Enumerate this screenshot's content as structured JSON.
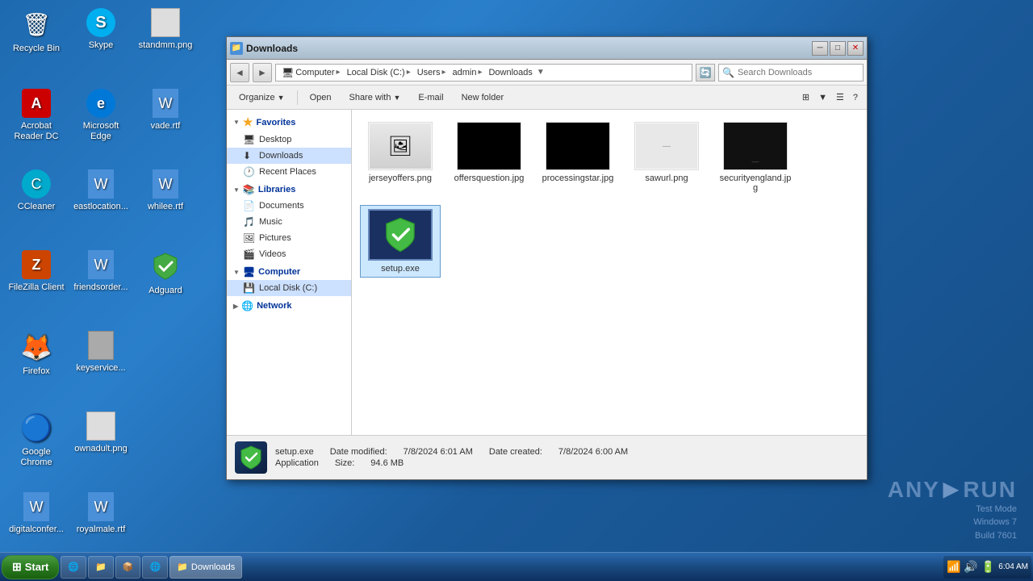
{
  "window": {
    "title": "Downloads",
    "titlebar_icon": "📁"
  },
  "address_bar": {
    "path": "Computer > Local Disk (C:) > Users > admin > Downloads",
    "segments": [
      "Computer",
      "Local Disk (C:)",
      "Users",
      "admin",
      "Downloads"
    ],
    "search_placeholder": "Search Downloads"
  },
  "toolbar": {
    "organize_label": "Organize",
    "open_label": "Open",
    "share_with_label": "Share with",
    "email_label": "E-mail",
    "new_folder_label": "New folder"
  },
  "sidebar": {
    "favorites_label": "Favorites",
    "favorites_items": [
      {
        "label": "Desktop",
        "icon": "🖥"
      },
      {
        "label": "Downloads",
        "icon": "⬇"
      },
      {
        "label": "Recent Places",
        "icon": "🕐"
      }
    ],
    "libraries_label": "Libraries",
    "libraries_items": [
      {
        "label": "Documents",
        "icon": "📄"
      },
      {
        "label": "Music",
        "icon": "🎵"
      },
      {
        "label": "Pictures",
        "icon": "🖼"
      },
      {
        "label": "Videos",
        "icon": "🎬"
      }
    ],
    "computer_label": "Computer",
    "computer_items": [
      {
        "label": "Local Disk (C:)",
        "icon": "💾"
      }
    ],
    "network_label": "Network"
  },
  "files": [
    {
      "name": "jerseyoffers.png",
      "type": "png",
      "thumb_style": "white"
    },
    {
      "name": "offersquestion.jpg",
      "type": "jpg",
      "thumb_style": "black"
    },
    {
      "name": "processingstar.jpg",
      "type": "jpg",
      "thumb_style": "black"
    },
    {
      "name": "sawurl.png",
      "type": "png",
      "thumb_style": "white"
    },
    {
      "name": "securityengland.jpg",
      "type": "jpg",
      "thumb_style": "dark"
    },
    {
      "name": "setup.exe",
      "type": "exe",
      "thumb_style": "adguard"
    }
  ],
  "status_bar": {
    "filename": "setup.exe",
    "date_modified_label": "Date modified:",
    "date_modified": "7/8/2024 6:01 AM",
    "date_created_label": "Date created:",
    "date_created": "7/8/2024 6:00 AM",
    "type_label": "Application",
    "size_label": "Size:",
    "size": "94.6 MB"
  },
  "desktop_icons": [
    {
      "label": "Recycle Bin",
      "icon": "🗑",
      "color": "#ccc"
    },
    {
      "label": "Skype",
      "icon": "S",
      "color": "#00aff0"
    },
    {
      "label": "standmm.png",
      "icon": "🖼",
      "color": "#aaa"
    },
    {
      "label": "Acrobat Reader DC",
      "icon": "A",
      "color": "#cc0000"
    },
    {
      "label": "Microsoft Edge",
      "icon": "e",
      "color": "#0078d7"
    },
    {
      "label": "vade.rtf",
      "icon": "📄",
      "color": "#4a90d9"
    },
    {
      "label": "CCleaner",
      "icon": "🧹",
      "color": "#00aacc"
    },
    {
      "label": "eastlocation...",
      "icon": "📄",
      "color": "#4a90d9"
    },
    {
      "label": "whilee.rtf",
      "icon": "📄",
      "color": "#4a90d9"
    },
    {
      "label": "FileZilla Client",
      "icon": "Z",
      "color": "#cc4400"
    },
    {
      "label": "friendsorder...",
      "icon": "📄",
      "color": "#4a90d9"
    },
    {
      "label": "Adguard",
      "icon": "✔",
      "color": "#44aa44"
    },
    {
      "label": "Firefox",
      "icon": "🦊",
      "color": "#ff6600"
    },
    {
      "label": "keyservice...",
      "icon": "📄",
      "color": "#aaa"
    },
    {
      "label": "",
      "icon": "",
      "color": ""
    },
    {
      "label": "Google Chrome",
      "icon": "C",
      "color": "#4285f4"
    },
    {
      "label": "ownadult.png",
      "icon": "🖼",
      "color": "#aaa"
    },
    {
      "label": "",
      "icon": "",
      "color": ""
    },
    {
      "label": "digitalconfer...",
      "icon": "📄",
      "color": "#4a90d9"
    },
    {
      "label": "royalmale.rtf",
      "icon": "📄",
      "color": "#4a90d9"
    },
    {
      "label": "",
      "icon": "",
      "color": ""
    }
  ],
  "taskbar": {
    "start_label": "Start",
    "taskbar_items": [
      {
        "label": "🌐",
        "title": "Internet Explorer"
      },
      {
        "label": "📁",
        "title": "File Explorer"
      },
      {
        "label": "📦",
        "title": "App"
      },
      {
        "label": "🌐",
        "title": "Browser"
      }
    ],
    "active_window": "Downloads",
    "time": "6:04 AM"
  },
  "watermark": {
    "text": "ANY ▶ RUN",
    "mode": "Test Mode",
    "os": "Windows 7",
    "build": "Build 7601"
  }
}
